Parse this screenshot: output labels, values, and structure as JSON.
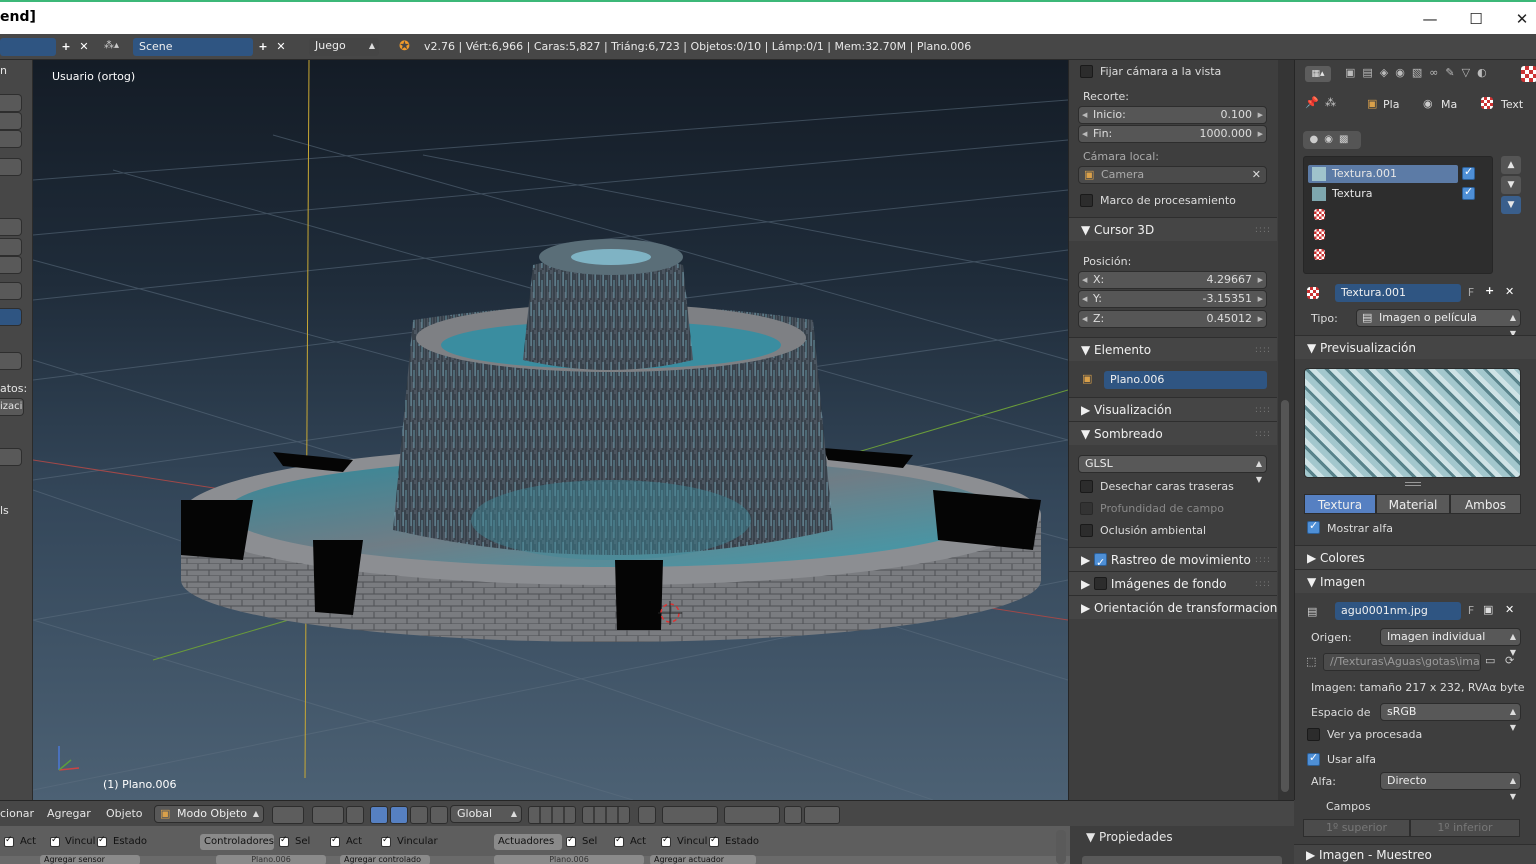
{
  "window": {
    "title": "end]",
    "minimize": "—",
    "maximize": "☐",
    "close": "✕"
  },
  "infobar": {
    "layout_field": "",
    "scene_name": "Scene",
    "engine": "Juego",
    "stats": "v2.76 | Vért:6,966 | Caras:5,827 | Triáng:6,723 | Objetos:0/10 | Lámp:0/1 | Mem:32.70M | Plano.006",
    "add_icon": "+",
    "close_icon": "✕"
  },
  "leftstrip": {
    "label_n": "n",
    "label_atos": "atos:",
    "label_zaci": "izaci",
    "label_ls": "ls"
  },
  "viewport": {
    "view_label": "Usuario (ortog)",
    "object_label": "(1) Plano.006"
  },
  "npanel": {
    "lock_camera": "Fijar cámara a la vista",
    "clip_label": "Recorte:",
    "clip_start_label": "Inicio:",
    "clip_start": "0.100",
    "clip_end_label": "Fin:",
    "clip_end": "1000.000",
    "local_camera_label": "Cámara local:",
    "local_camera": "Camera",
    "render_border": "Marco de procesamiento",
    "cursor_header": "Cursor 3D",
    "position_label": "Posición:",
    "cursor_x_label": "X:",
    "cursor_x": "4.29667",
    "cursor_y_label": "Y:",
    "cursor_y": "-3.15351",
    "cursor_z_label": "Z:",
    "cursor_z": "0.45012",
    "item_header": "Elemento",
    "item_name": "Plano.006",
    "display_header": "Visualización",
    "shading_header": "Sombreado",
    "shading_mode": "GLSL",
    "backface": "Desechar caras traseras",
    "dof": "Profundidad de campo",
    "ao": "Oclusión ambiental",
    "motion_tracking": "Rastreo de movimiento",
    "bg_images": "Imágenes de fondo",
    "transform_orient": "Orientación de transformaciones"
  },
  "props": {
    "breadcrumb": [
      "Pla",
      "Ma",
      "Text"
    ],
    "textures": [
      "Textura.001",
      "Textura"
    ],
    "texture_name": "Textura.001",
    "texture_f": "F",
    "type_label": "Tipo:",
    "type_value": "Imagen o película",
    "preview_header": "Previsualización",
    "tabs": [
      "Textura",
      "Material",
      "Ambos"
    ],
    "show_alpha": "Mostrar alfa",
    "colors_header": "Colores",
    "image_header": "Imagen",
    "image_name": "agu0001nm.jpg",
    "image_f": "F",
    "source_label": "Origen:",
    "source_value": "Imagen individual",
    "filepath": "//Texturas\\Aguas\\gotas\\ima...",
    "image_info": "Imagen: tamaño 217 x 232, RVAα byte",
    "colorspace_label": "Espacio de",
    "colorspace_value": "sRGB",
    "view_processed": "Ver ya procesada",
    "use_alpha": "Usar alfa",
    "alpha_label": "Alfa:",
    "alpha_value": "Directo",
    "fields": "Campos",
    "field_upper": "1º superior",
    "field_lower": "1º inferior",
    "sampling_header": "Imagen - Muestreo"
  },
  "bottombar": {
    "select_menu": "cionar",
    "add_menu": "Agregar",
    "object_menu": "Objeto",
    "mode": "Modo Objeto",
    "orientation": "Global"
  },
  "logic": {
    "act": "Act",
    "link": "Vincul",
    "state": "Estado",
    "controllers": "Controladores",
    "sel": "Sel",
    "act2": "Act",
    "link2": "Vincular",
    "actuators": "Actuadores",
    "sel2": "Sel",
    "act3": "Act",
    "link3": "Vincul",
    "state2": "Estado",
    "add_sensor": "Agregar sensor",
    "plano1": "Plano.006",
    "add_controller": "Agregar controlado",
    "plano2": "Plano.006",
    "add_actuator": "Agregar actuador"
  },
  "bottomright": {
    "properties_header": "Propiedades"
  }
}
